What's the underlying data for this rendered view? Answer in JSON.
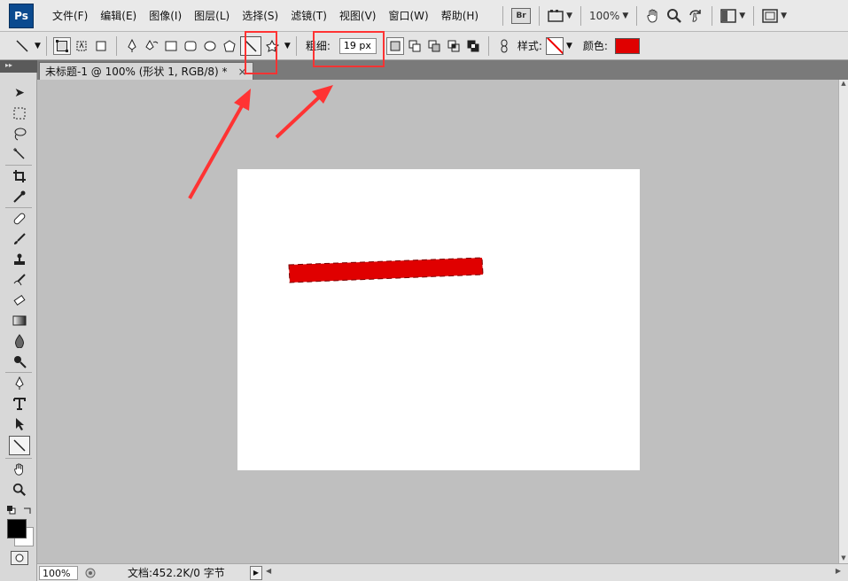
{
  "app": {
    "logo": "Ps"
  },
  "menu": [
    {
      "id": "file",
      "label": "文件(F)"
    },
    {
      "id": "edit",
      "label": "编辑(E)"
    },
    {
      "id": "image",
      "label": "图像(I)"
    },
    {
      "id": "layer",
      "label": "图层(L)"
    },
    {
      "id": "select",
      "label": "选择(S)"
    },
    {
      "id": "filter",
      "label": "滤镜(T)"
    },
    {
      "id": "view",
      "label": "视图(V)"
    },
    {
      "id": "window",
      "label": "窗口(W)"
    },
    {
      "id": "help",
      "label": "帮助(H)"
    }
  ],
  "menu_right": {
    "bridge_label": "Br",
    "zoom": "100%"
  },
  "options": {
    "weight_label": "粗细:",
    "weight_value": "19 px",
    "style_label": "样式:",
    "color_label": "颜色:",
    "color": "#e00000"
  },
  "document": {
    "tab_title": "未标题-1 @ 100% (形状 1, RGB/8) *",
    "close": "×"
  },
  "status": {
    "zoom": "100%",
    "doc_info": "文档:452.2K/0 字节"
  },
  "colors": {
    "annotation": "#ff3333",
    "shape_fill": "#e00000",
    "foreground": "#000000",
    "background": "#ffffff"
  },
  "icons": {
    "move": "move-icon",
    "marquee": "marquee-icon",
    "lasso": "lasso-icon",
    "magic_wand": "quick-select-icon",
    "crop": "crop-icon",
    "eyedropper": "eyedropper-icon",
    "healing": "healing-brush-icon",
    "brush": "brush-icon",
    "stamp": "clone-stamp-icon",
    "history_brush": "history-brush-icon",
    "eraser": "eraser-icon",
    "gradient": "gradient-icon",
    "blur": "blur-icon",
    "dodge": "dodge-icon",
    "pen": "pen-icon",
    "type": "type-icon",
    "path_select": "path-select-icon",
    "line": "line-tool-icon",
    "hand": "hand-icon",
    "zoom": "zoom-icon"
  }
}
